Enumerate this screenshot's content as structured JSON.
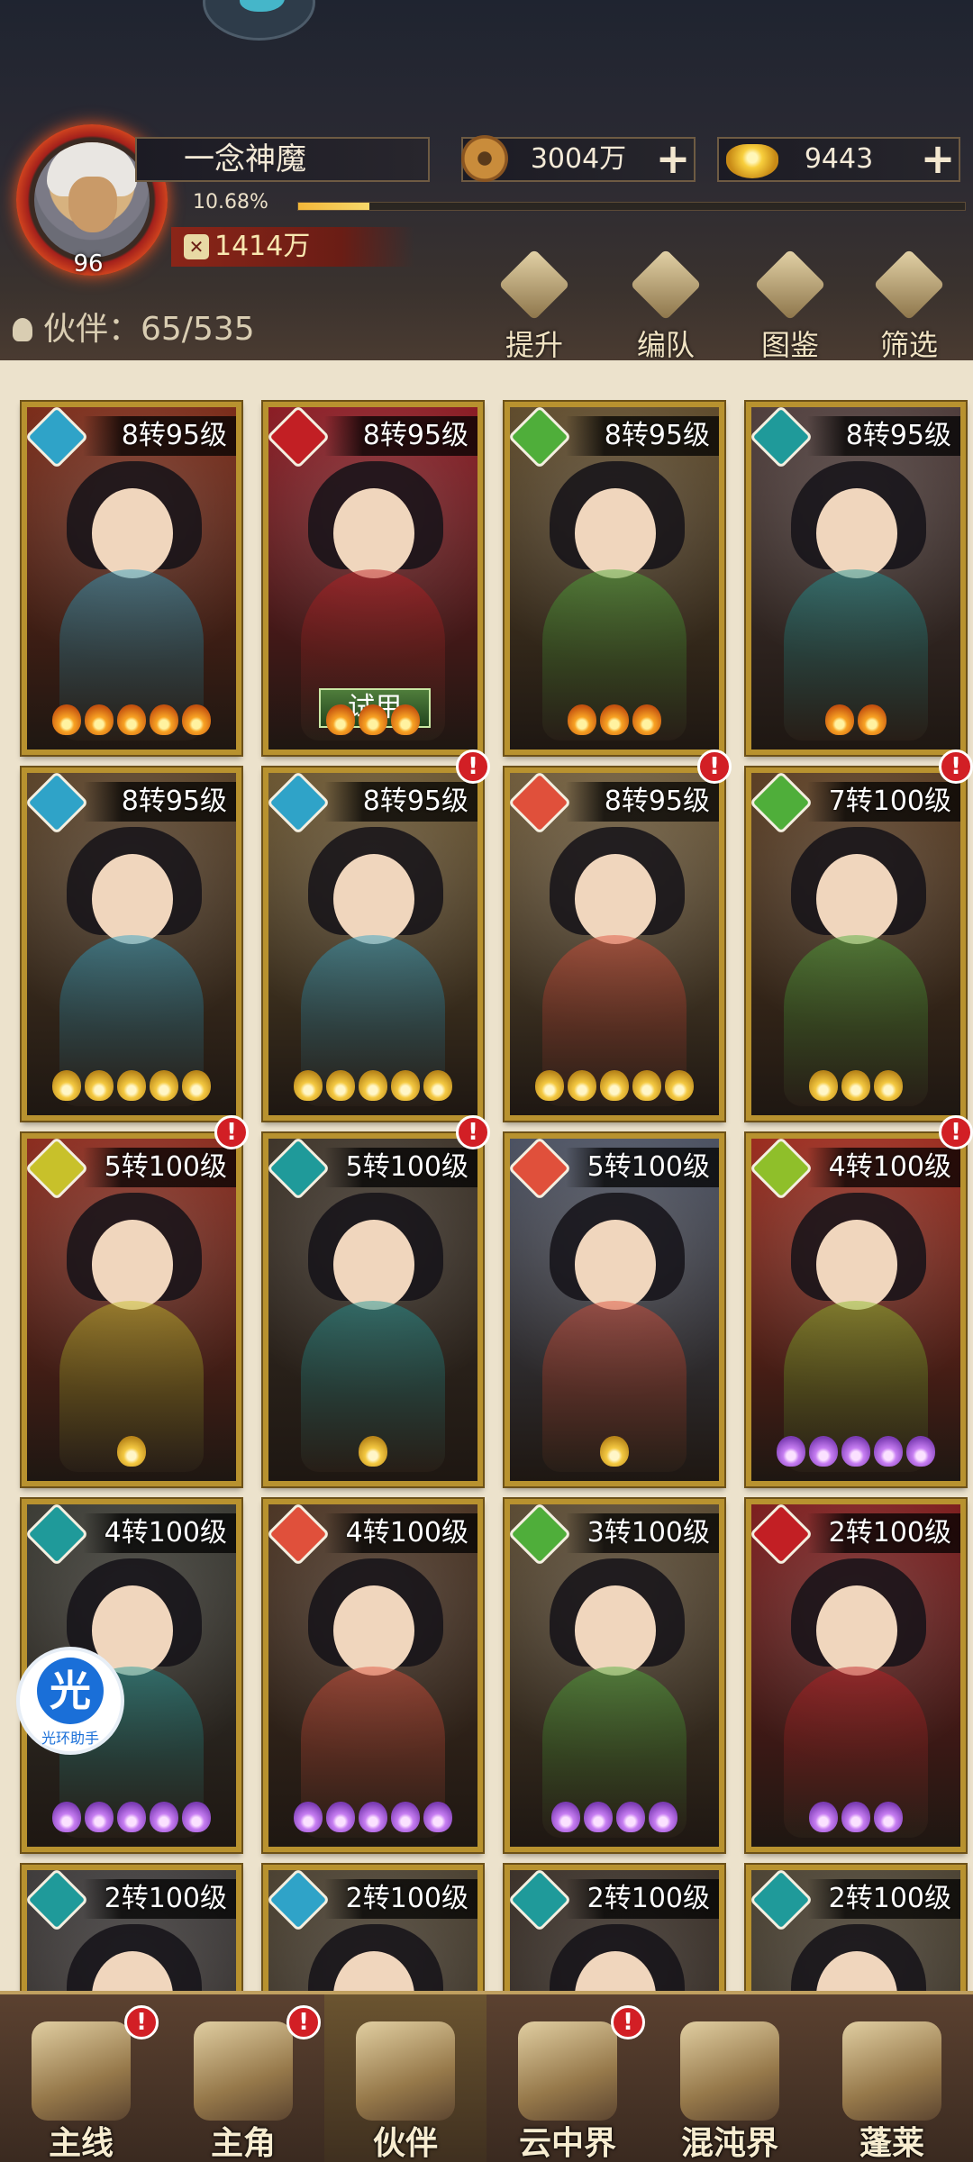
{
  "player": {
    "name": "一念神魔",
    "level": "96",
    "exp_percent": "10.68%",
    "exp_fraction": 0.1068,
    "power": "1414万"
  },
  "currencies": {
    "copper": "3004万",
    "gold": "9443"
  },
  "companion_count": "伙伴：65/535",
  "actions": [
    {
      "label": "提升",
      "icon": "upgrade-icon"
    },
    {
      "label": "编队",
      "icon": "formation-icon"
    },
    {
      "label": "图鉴",
      "icon": "codex-icon"
    },
    {
      "label": "筛选",
      "icon": "filter-icon"
    }
  ],
  "cards": [
    {
      "level": "8转95级",
      "stars": 5,
      "star_color": "orange",
      "bg": "#7a2a17",
      "element": "#2fa3c8",
      "alert": false
    },
    {
      "level": "8转95级",
      "stars": 3,
      "star_color": "orange",
      "bg": "#8a1a22",
      "element": "#c21f24",
      "alert": false,
      "trial": "试用"
    },
    {
      "level": "8转95级",
      "stars": 3,
      "star_color": "orange",
      "bg": "#5e4a2a",
      "element": "#4fae3a",
      "alert": false
    },
    {
      "level": "8转95级",
      "stars": 2,
      "star_color": "orange",
      "bg": "#4e3c3a",
      "element": "#1f9a9a",
      "alert": false
    },
    {
      "level": "8转95级",
      "stars": 5,
      "star_color": "gold",
      "bg": "#5a4228",
      "element": "#2fa3c8",
      "alert": false
    },
    {
      "level": "8转95级",
      "stars": 5,
      "star_color": "gold",
      "bg": "#6a5530",
      "element": "#2fa3c8",
      "alert": true
    },
    {
      "level": "8转95级",
      "stars": 5,
      "star_color": "gold",
      "bg": "#6f5b3a",
      "element": "#e0503b",
      "alert": true
    },
    {
      "level": "7转100级",
      "stars": 3,
      "star_color": "gold",
      "bg": "#5a3d22",
      "element": "#4fae3a",
      "alert": true
    },
    {
      "level": "5转100级",
      "stars": 1,
      "star_color": "gold",
      "bg": "#8a2a1c",
      "element": "#c8c12a",
      "alert": true
    },
    {
      "level": "5转100级",
      "stars": 1,
      "star_color": "gold",
      "bg": "#3d3328",
      "element": "#1f9a9a",
      "alert": true
    },
    {
      "level": "5转100级",
      "stars": 1,
      "star_color": "gold",
      "bg": "#4a5060",
      "element": "#e0503b",
      "alert": false
    },
    {
      "level": "4转100级",
      "stars": 5,
      "star_color": "purple",
      "bg": "#9a2a1c",
      "element": "#8fbf2a",
      "alert": true
    },
    {
      "level": "4转100级",
      "stars": 5,
      "star_color": "purple",
      "bg": "#3a3a33",
      "element": "#1f9a9a",
      "alert": false
    },
    {
      "level": "4转100级",
      "stars": 5,
      "star_color": "purple",
      "bg": "#4b3423",
      "element": "#e0503b",
      "alert": false
    },
    {
      "level": "3转100级",
      "stars": 4,
      "star_color": "purple",
      "bg": "#5a4a32",
      "element": "#4fae3a",
      "alert": false
    },
    {
      "level": "2转100级",
      "stars": 3,
      "star_color": "purple",
      "bg": "#7c1c1c",
      "element": "#c21f24",
      "alert": false
    },
    {
      "level": "2转100级",
      "stars": 0,
      "star_color": "purple",
      "bg": "#3d3a3a",
      "element": "#1f9a9a",
      "alert": false
    },
    {
      "level": "2转100级",
      "stars": 0,
      "star_color": "purple",
      "bg": "#4a4030",
      "element": "#2fa3c8",
      "alert": false
    },
    {
      "level": "2转100级",
      "stars": 0,
      "star_color": "purple",
      "bg": "#3a3028",
      "element": "#1f9a9a",
      "alert": false
    },
    {
      "level": "2转100级",
      "stars": 0,
      "star_color": "purple",
      "bg": "#4b4232",
      "element": "#1f9a9a",
      "alert": false
    }
  ],
  "floating_helper": {
    "glyph": "光",
    "caption": "光环助手"
  },
  "nav": [
    {
      "label": "主线",
      "icon": "main-quest-icon",
      "alert": true
    },
    {
      "label": "主角",
      "icon": "hero-icon",
      "alert": true
    },
    {
      "label": "伙伴",
      "icon": "companion-icon",
      "alert": false,
      "active": true
    },
    {
      "label": "云中界",
      "icon": "cloud-realm-icon",
      "alert": true
    },
    {
      "label": "混沌界",
      "icon": "chaos-realm-icon",
      "alert": false
    },
    {
      "label": "蓬莱",
      "icon": "penglai-icon",
      "alert": false
    }
  ]
}
